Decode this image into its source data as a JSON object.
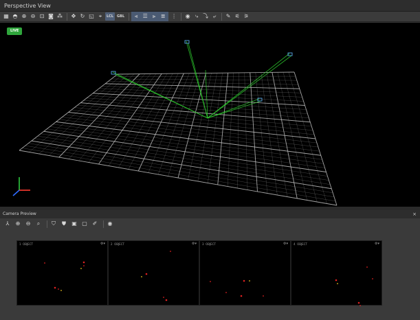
{
  "window": {
    "title": "Perspective View"
  },
  "toolbar": {
    "icons": [
      "grid-icon",
      "sphere-icon",
      "zoom-in-icon",
      "zoom-out-icon",
      "zoom-fit-icon",
      "camera-icon",
      "nodes-icon",
      "move-icon",
      "rotate-icon",
      "scale-icon",
      "pivot-icon"
    ],
    "local_label": "LCL",
    "global_label": "GBL",
    "group_icons": [
      "align-left-icon",
      "align-center-icon",
      "align-right-icon",
      "align-distribute-icon"
    ],
    "tail_icons": [
      "eye-icon",
      "path-a-icon",
      "path-b-icon",
      "path-c-icon",
      "pencil-cursor-icon",
      "snap-a-icon",
      "snap-b-icon"
    ]
  },
  "viewport": {
    "live_badge": "LIVE",
    "grid_color": "#bfbfbf",
    "ray_color": "#2ecc2e",
    "camera_color": "#5aa7e8"
  },
  "camera_preview": {
    "title": "Camera Preview",
    "close": "×",
    "toolbar_icons": [
      "axes-icon",
      "zoom-in-icon",
      "zoom-out-icon",
      "search-icon",
      "shield-icon",
      "shield-filled-icon",
      "frame-icon",
      "frame-b-icon",
      "brush-icon",
      "eye-icon"
    ],
    "gear": "⚙▾",
    "cameras": [
      {
        "index": "1",
        "label": "OBJECT"
      },
      {
        "index": "2",
        "label": "OBJECT"
      },
      {
        "index": "3",
        "label": "OBJECT"
      },
      {
        "index": "4",
        "label": "OBJECT"
      }
    ]
  }
}
